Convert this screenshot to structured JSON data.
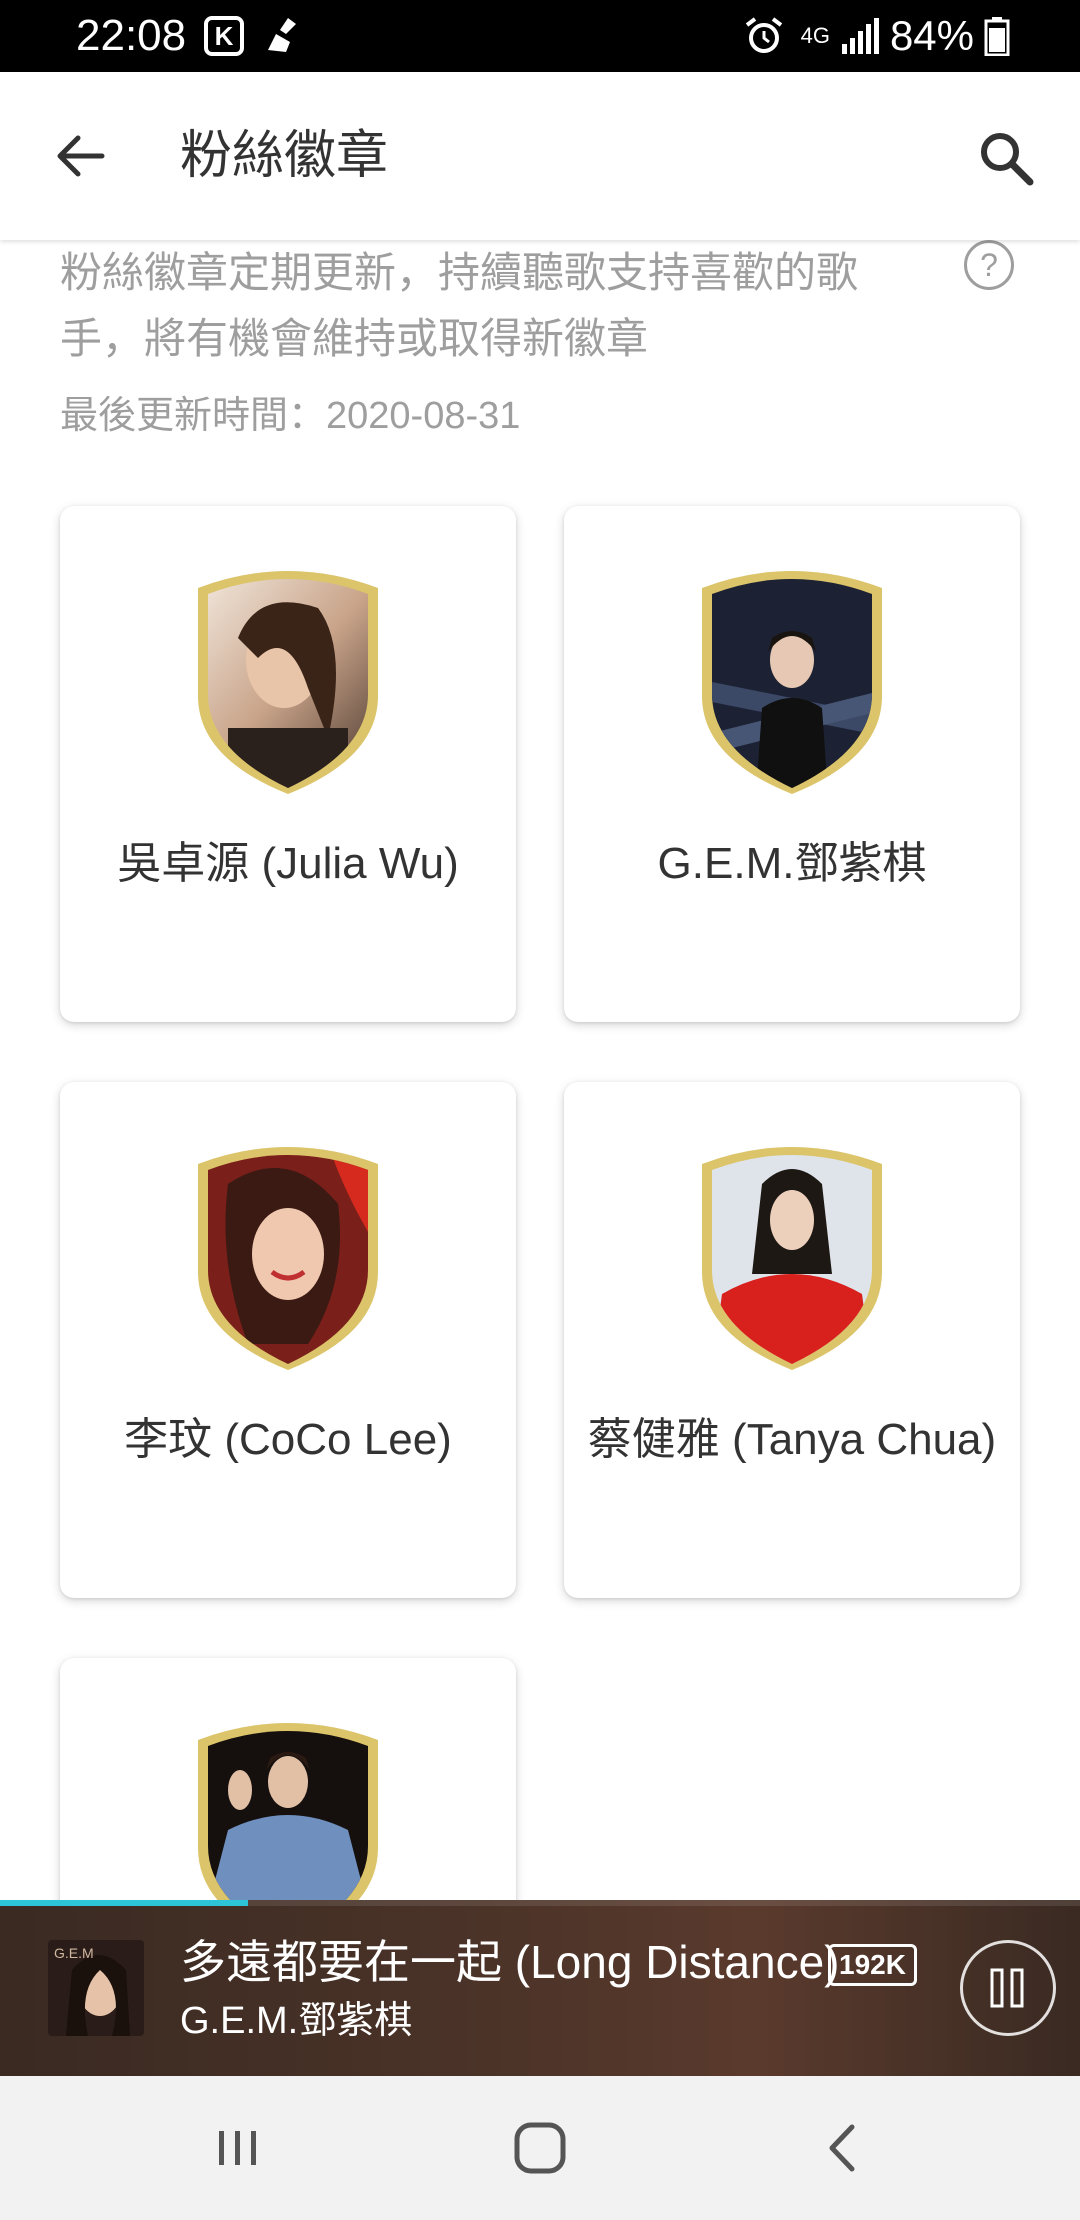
{
  "status_bar": {
    "time": "22:08",
    "app_icon_letter": "K",
    "network": "4G",
    "battery": "84%"
  },
  "app_bar": {
    "title": "粉絲徽章",
    "back_icon": "arrow-left-icon",
    "search_icon": "search-icon"
  },
  "info": {
    "description": "粉絲徽章定期更新，持續聽歌支持喜歡的歌手，將有機會維持或取得新徽章",
    "help_symbol": "?",
    "last_updated": "最後更新時間：2020-08-31"
  },
  "badges": [
    {
      "name": "吳卓源 (Julia Wu)"
    },
    {
      "name": "G.E.M.鄧紫棋"
    },
    {
      "name": "李玟 (CoCo Lee)"
    },
    {
      "name": "蔡健雅 (Tanya Chua)"
    },
    {
      "name": ""
    }
  ],
  "player": {
    "track_title": "多遠都要在一起 (Long Distance)",
    "quality": "192K",
    "artist": "G.E.M.鄧紫棋",
    "progress": 0.23,
    "accent_color": "#2ec4d8"
  },
  "colors": {
    "badge_gold": "#dcc46a",
    "text_secondary": "#9e9e9e"
  }
}
